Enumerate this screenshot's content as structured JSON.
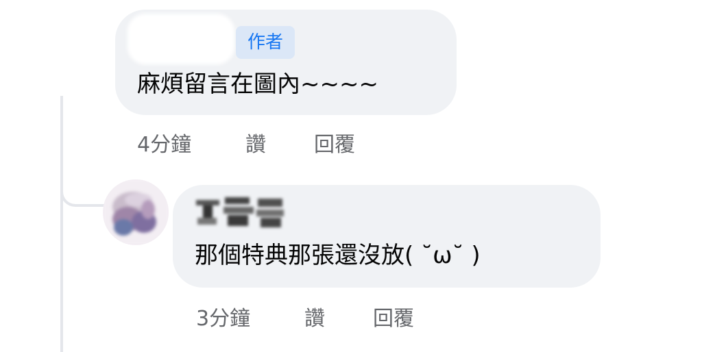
{
  "comments": [
    {
      "author_badge": "作者",
      "text": "麻煩留言在圖內~~~~",
      "time": "4分鐘",
      "like_label": "讚",
      "reply_label": "回覆"
    },
    {
      "text": "那個特典那張還沒放(  ˘ω˘ )",
      "time": "3分鐘",
      "like_label": "讚",
      "reply_label": "回覆"
    }
  ],
  "colors": {
    "bubble": "#f0f2f5",
    "badge_bg": "#dbe7f7",
    "badge_text": "#1877f2",
    "meta_text": "#65676b",
    "thread_line": "#e4e6eb"
  }
}
